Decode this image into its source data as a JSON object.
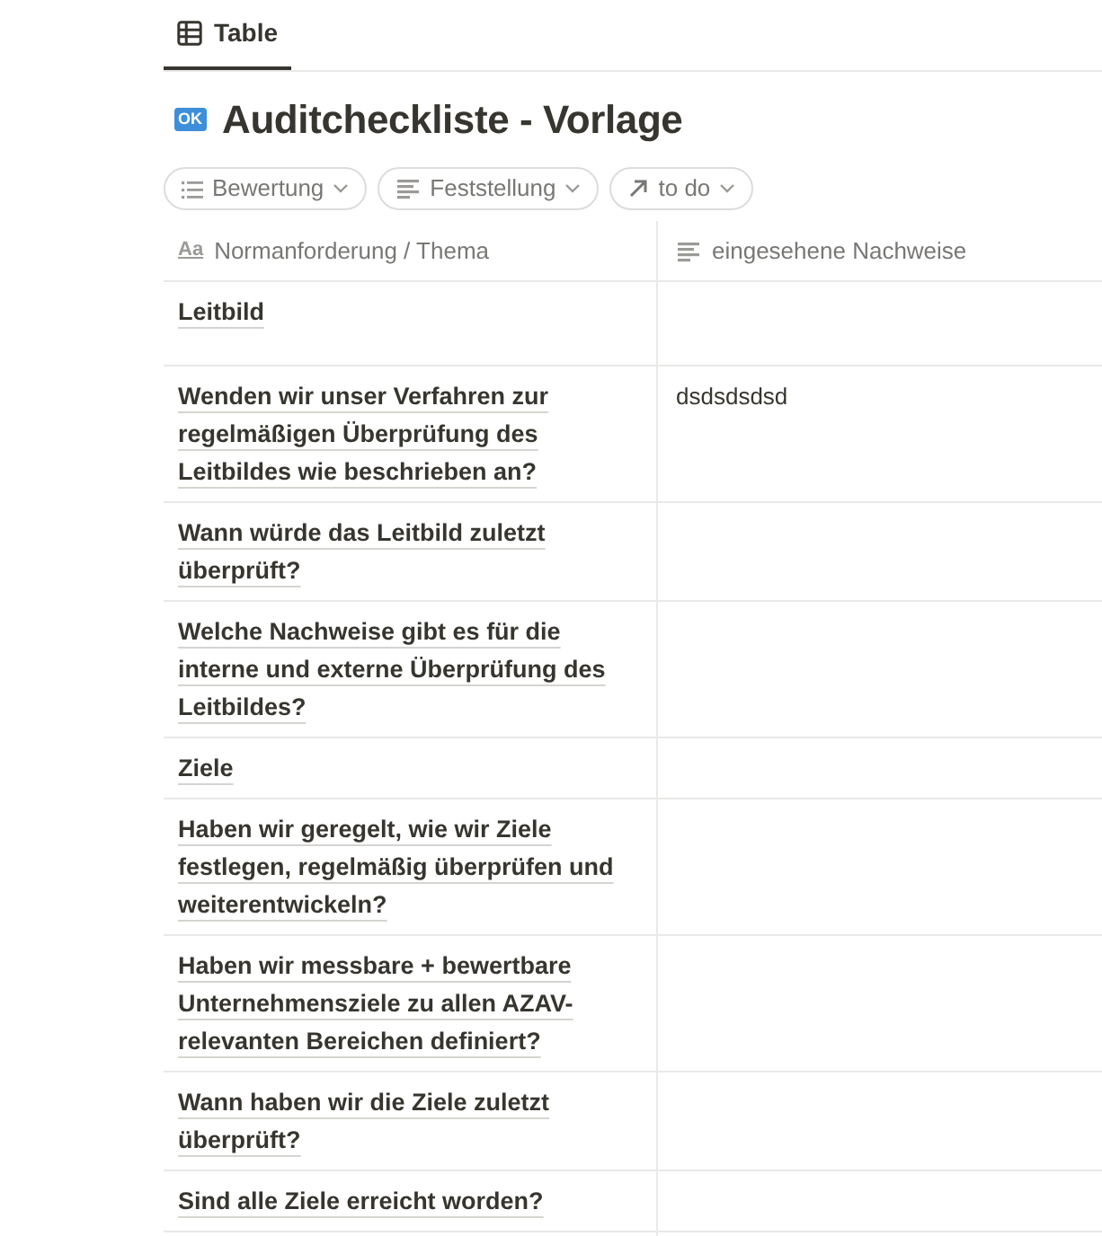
{
  "tabs": [
    {
      "label": "Table",
      "selected": true
    }
  ],
  "title": {
    "badge": "OK",
    "text": "Auditcheckliste - Vorlage"
  },
  "filters": [
    {
      "kind": "list",
      "label": "Bewertung"
    },
    {
      "kind": "text",
      "label": "Feststellung"
    },
    {
      "kind": "relation",
      "label": "to do"
    }
  ],
  "table": {
    "columns": [
      {
        "kind": "title",
        "glyph": "Aa",
        "label": "Normanforderung / Thema"
      },
      {
        "kind": "text",
        "label": "eingesehene Nachweise"
      }
    ],
    "rows": [
      {
        "title": "Leitbild"
      },
      {
        "title": "Wenden wir unser Verfahren zur regelmäßigen Überprüfung des Leitbildes wie beschrieben an?",
        "evidence": "dsdsdsdsd"
      },
      {
        "title": "Wann würde das Leitbild zuletzt überprüft?"
      },
      {
        "title": "Welche Nachweise gibt es für die interne und externe Überprüfung des Leitbildes?"
      },
      {
        "title": "Ziele"
      },
      {
        "title": "Haben wir geregelt, wie wir Ziele festlegen, regelmäßig überprüfen und weiterentwickeln?"
      },
      {
        "title": "Haben wir messbare + bewertbare Unternehmensziele zu allen AZAV-relevanten Bereichen definiert?"
      },
      {
        "title": "Wann haben wir die Ziele zuletzt überprüft?"
      },
      {
        "title": "Sind alle Ziele erreicht worden?"
      }
    ]
  }
}
